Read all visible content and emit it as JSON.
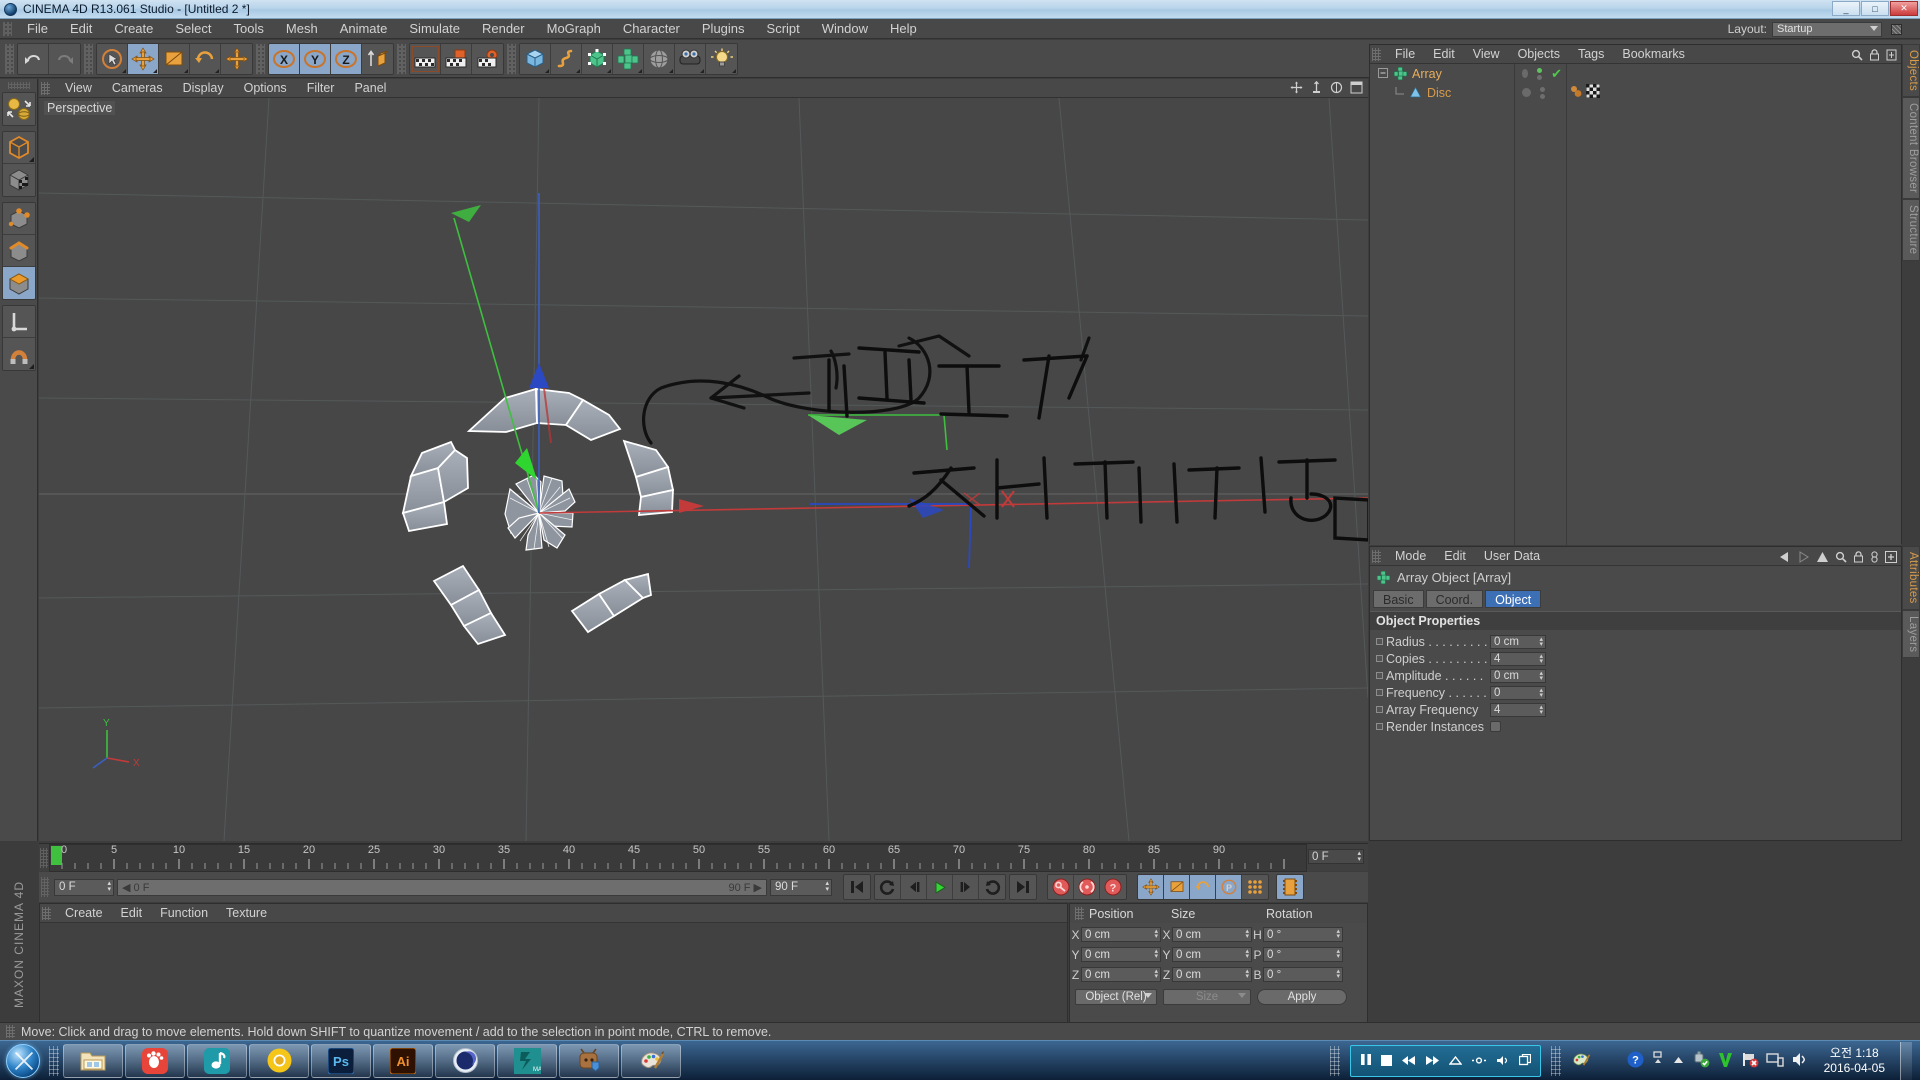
{
  "window": {
    "title": "CINEMA 4D R13.061 Studio - [Untitled 2 *]",
    "minimize": "_",
    "maximize": "□",
    "close": "✕"
  },
  "menubar": {
    "items": [
      "File",
      "Edit",
      "Create",
      "Select",
      "Tools",
      "Mesh",
      "Animate",
      "Simulate",
      "Render",
      "MoGraph",
      "Character",
      "Plugins",
      "Script",
      "Window",
      "Help"
    ],
    "layout_label": "Layout:",
    "layout_value": "Startup"
  },
  "toolbar": {
    "groups": [
      {
        "name": "undo-redo",
        "buttons": [
          {
            "name": "undo-button",
            "icon": "undo",
            "state": "off"
          },
          {
            "name": "redo-button",
            "icon": "redo",
            "state": "disabled"
          }
        ]
      },
      {
        "name": "transform-tools",
        "buttons": [
          {
            "name": "live-selection-tool",
            "icon": "cursor-circle",
            "state": "off"
          },
          {
            "name": "move-tool",
            "icon": "move-arrows",
            "state": "on"
          },
          {
            "name": "scale-tool",
            "icon": "scale-square",
            "state": "off"
          },
          {
            "name": "rotate-tool",
            "icon": "rotate-arc",
            "state": "off"
          },
          {
            "name": "move-alt-tool",
            "icon": "move-arrows",
            "state": "off"
          }
        ]
      },
      {
        "name": "axis-locks",
        "buttons": [
          {
            "name": "lock-x-axis",
            "icon": "x-axis",
            "state": "on"
          },
          {
            "name": "lock-y-axis",
            "icon": "y-axis",
            "state": "on"
          },
          {
            "name": "lock-z-axis",
            "icon": "z-axis",
            "state": "on"
          },
          {
            "name": "world-object-axis",
            "icon": "axis-world",
            "state": "off"
          }
        ]
      },
      {
        "name": "render-tools",
        "buttons": [
          {
            "name": "render-view-button",
            "icon": "clapper-frame",
            "state": "off"
          },
          {
            "name": "render-region-button",
            "icon": "clapper-region",
            "state": "off"
          },
          {
            "name": "render-settings-button",
            "icon": "clapper-gear",
            "state": "off"
          }
        ]
      },
      {
        "name": "create-objects",
        "buttons": [
          {
            "name": "add-cube-button",
            "icon": "cube-blue",
            "state": "off"
          },
          {
            "name": "add-spline-button",
            "icon": "spline-curve",
            "state": "off"
          },
          {
            "name": "add-generator-button",
            "icon": "nurbs-green",
            "state": "off"
          },
          {
            "name": "add-array-button",
            "icon": "array-green",
            "state": "off"
          },
          {
            "name": "add-scene-button",
            "icon": "scene-ball",
            "state": "off"
          },
          {
            "name": "add-camera-button",
            "icon": "camera",
            "state": "off"
          },
          {
            "name": "add-light-button",
            "icon": "light-bulb",
            "state": "off"
          }
        ]
      }
    ]
  },
  "left_palette": {
    "groups": [
      [
        {
          "name": "texture-axis-tool",
          "icon": "texture-sphere"
        }
      ],
      [
        {
          "name": "model-mode-button",
          "icon": "cube-outline-orange"
        },
        {
          "name": "texture-mode-button",
          "icon": "cube-checker"
        }
      ],
      [
        {
          "name": "points-mode-button",
          "icon": "cube-points"
        },
        {
          "name": "edges-mode-button",
          "icon": "cube-edges"
        },
        {
          "name": "polygons-mode-button",
          "icon": "cube-polygon"
        }
      ],
      [
        {
          "name": "enable-axis-modification",
          "icon": "axis-L"
        },
        {
          "name": "enable-snap-button",
          "icon": "magnet"
        }
      ]
    ]
  },
  "viewport": {
    "menu": [
      "View",
      "Cameras",
      "Display",
      "Options",
      "Filter",
      "Panel"
    ],
    "label": "Perspective",
    "axis_gizmo": {
      "y": "Y",
      "x": "X"
    }
  },
  "object_manager": {
    "menu": [
      "File",
      "Edit",
      "View",
      "Objects",
      "Tags",
      "Bookmarks"
    ],
    "items": [
      {
        "name": "Array",
        "type": "array",
        "selected": true,
        "depth": 0
      },
      {
        "name": "Disc",
        "type": "disc",
        "selected": false,
        "depth": 1
      }
    ]
  },
  "attributes": {
    "menu": [
      "Mode",
      "Edit",
      "User Data"
    ],
    "object_title": "Array Object [Array]",
    "tabs": [
      {
        "label": "Basic",
        "active": false
      },
      {
        "label": "Coord.",
        "active": false
      },
      {
        "label": "Object",
        "active": true
      }
    ],
    "section_title": "Object Properties",
    "properties": [
      {
        "label": "Radius . . . . . . . . .",
        "value": "0 cm",
        "type": "number"
      },
      {
        "label": "Copies . . . . . . . . .",
        "value": "4",
        "type": "number"
      },
      {
        "label": "Amplitude . . . . . .",
        "value": "0 cm",
        "type": "number"
      },
      {
        "label": "Frequency . . . . . .",
        "value": "0",
        "type": "number"
      },
      {
        "label": "Array Frequency",
        "value": "4",
        "type": "number"
      },
      {
        "label": "Render Instances",
        "value": "",
        "type": "checkbox"
      }
    ]
  },
  "side_tabs_top": [
    {
      "label": "Objects",
      "active": true
    },
    {
      "label": "Content Browser",
      "active": false
    },
    {
      "label": "Structure",
      "active": false
    }
  ],
  "side_tabs_bottom": [
    {
      "label": "Attributes",
      "active": true
    },
    {
      "label": "Layers",
      "active": false
    }
  ],
  "timeline": {
    "ticks": [
      "0",
      "5",
      "10",
      "15",
      "20",
      "25",
      "30",
      "35",
      "40",
      "45",
      "50",
      "55",
      "60",
      "65",
      "70",
      "75",
      "80",
      "85",
      "90"
    ],
    "current_frame_box": "0 F",
    "start_field": "0 F",
    "slider_left": "0 F",
    "slider_right": "90 F",
    "end_field": "90 F",
    "transport": [
      {
        "name": "goto-start-button",
        "icon": "skip-start"
      },
      {
        "name": "previous-key-button",
        "icon": "prev-key"
      },
      {
        "name": "step-back-button",
        "icon": "step-back"
      },
      {
        "name": "play-button",
        "icon": "play"
      },
      {
        "name": "step-forward-button",
        "icon": "step-forward"
      },
      {
        "name": "next-key-button",
        "icon": "next-key"
      },
      {
        "name": "goto-end-button",
        "icon": "skip-end"
      }
    ],
    "record": [
      {
        "name": "record-active-objects-button",
        "icon": "key-record"
      },
      {
        "name": "autokeying-button",
        "icon": "auto-key"
      },
      {
        "name": "keyframe-selection-button",
        "icon": "question-key"
      }
    ],
    "param_toggles": [
      {
        "name": "position-keyframe-toggle",
        "icon": "move-arrows",
        "state": "on"
      },
      {
        "name": "scale-keyframe-toggle",
        "icon": "scale-square",
        "state": "on"
      },
      {
        "name": "rotation-keyframe-toggle",
        "icon": "rotate-arc",
        "state": "on"
      },
      {
        "name": "param-keyframe-toggle",
        "icon": "p-circle",
        "state": "on"
      },
      {
        "name": "pla-keyframe-toggle",
        "icon": "dots-grid",
        "state": "off"
      },
      {
        "name": "timeline-button",
        "icon": "filmstrip",
        "state": "on"
      }
    ]
  },
  "material_manager": {
    "menu": [
      "Create",
      "Edit",
      "Function",
      "Texture"
    ]
  },
  "coordinates": {
    "headers": [
      "Position",
      "Size",
      "Rotation"
    ],
    "rows": [
      {
        "pos_axis": "X",
        "pos_value": "0 cm",
        "size_axis": "X",
        "size_value": "0 cm",
        "rot_axis": "H",
        "rot_value": "0 °"
      },
      {
        "pos_axis": "Y",
        "pos_value": "0 cm",
        "size_axis": "Y",
        "size_value": "0 cm",
        "rot_axis": "P",
        "rot_value": "0 °"
      },
      {
        "pos_axis": "Z",
        "pos_value": "0 cm",
        "size_axis": "Z",
        "size_value": "0 cm",
        "rot_axis": "B",
        "rot_value": "0 °"
      }
    ],
    "mode_dropdown": "Object (Rel)",
    "size_dropdown": "Size",
    "apply_button": "Apply"
  },
  "status_bar": {
    "text": "Move: Click and drag to move elements. Hold down SHIFT to quantize movement / add to the selection in point mode, CTRL to remove."
  },
  "brand_strip": {
    "text": "MAXON CINEMA 4D"
  },
  "taskbar": {
    "start_name": "start-orb",
    "items": [
      {
        "name": "taskbar-explorer",
        "icon": "folder"
      },
      {
        "name": "taskbar-gom-player",
        "icon": "gom"
      },
      {
        "name": "taskbar-music",
        "icon": "note"
      },
      {
        "name": "taskbar-chrome",
        "icon": "chrome"
      },
      {
        "name": "taskbar-photoshop",
        "icon": "ps"
      },
      {
        "name": "taskbar-illustrator",
        "icon": "ai"
      },
      {
        "name": "taskbar-cinema4d",
        "icon": "c4d"
      },
      {
        "name": "taskbar-3dsmax",
        "icon": "max"
      },
      {
        "name": "taskbar-unknown-app",
        "icon": "shield-app"
      },
      {
        "name": "taskbar-paint",
        "icon": "palette"
      }
    ],
    "media_controls": [
      {
        "name": "media-pause-button",
        "icon": "pause"
      },
      {
        "name": "media-stop-button",
        "icon": "stop"
      },
      {
        "name": "media-prev-button",
        "icon": "prev"
      },
      {
        "name": "media-next-button",
        "icon": "next"
      },
      {
        "name": "media-eject-button",
        "icon": "eject"
      },
      {
        "name": "media-brightness-button",
        "icon": "brightness"
      },
      {
        "name": "media-volume-button",
        "icon": "volume"
      },
      {
        "name": "media-window-button",
        "icon": "window"
      }
    ],
    "tray": [
      {
        "name": "tray-help-icon",
        "icon": "help"
      },
      {
        "name": "tray-network-icon",
        "icon": "network-arrow"
      },
      {
        "name": "tray-show-hidden-icon",
        "icon": "chevron-up"
      },
      {
        "name": "tray-safely-remove-icon",
        "icon": "usb-check"
      },
      {
        "name": "tray-antivirus-icon",
        "icon": "v3-green"
      },
      {
        "name": "tray-flag-icon",
        "icon": "flag-error"
      },
      {
        "name": "tray-monitor-icon",
        "icon": "monitor"
      },
      {
        "name": "tray-speaker-icon",
        "icon": "speaker"
      }
    ],
    "clock_time": "오전 1:18",
    "clock_date": "2016-04-05"
  },
  "colors": {
    "accent_blue": "#3d6fb5",
    "orange": "#d79b4a",
    "panel_bg": "#4a4a4a",
    "viewport_bg": "#474747",
    "x_axis": "#c23a3a",
    "y_axis": "#3fbf3f",
    "z_axis": "#3a5fc2"
  }
}
